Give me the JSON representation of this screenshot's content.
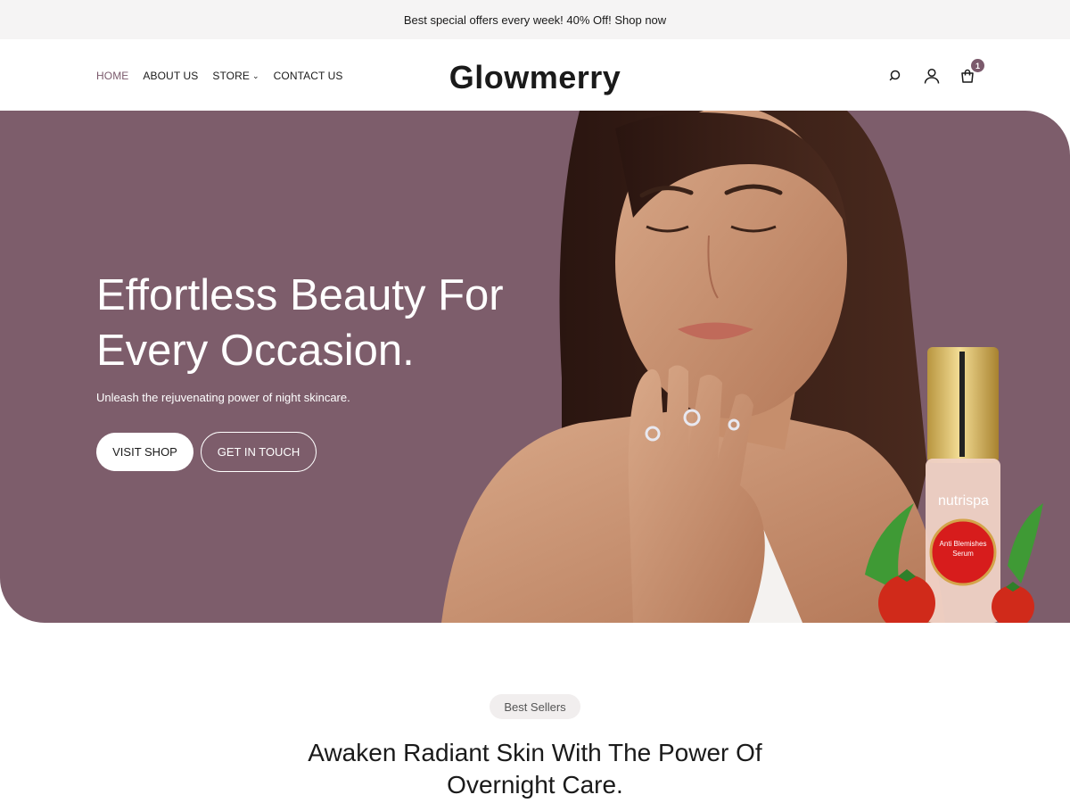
{
  "announcement": {
    "text": "Best special offers every week! 40% Off! Shop now"
  },
  "header": {
    "logo": "Glowmerry",
    "nav": [
      {
        "label": "HOME",
        "active": true
      },
      {
        "label": "ABOUT US"
      },
      {
        "label": "STORE",
        "has_dropdown": true
      },
      {
        "label": "CONTACT US"
      }
    ],
    "icons": [
      "search-icon",
      "user-icon",
      "cart-icon"
    ],
    "cart_count": "1"
  },
  "hero": {
    "title_line1": "Effortless Beauty For",
    "title_line2": "Every Occasion.",
    "subtitle": "Unleash the rejuvenating power of night skincare.",
    "primary_button": "VISIT SHOP",
    "secondary_button": "GET IN TOUCH",
    "background_color": "#7d5d6b",
    "product_brand": "nutrispa",
    "product_label_1": "Anti Blemishes",
    "product_label_2": "Serum"
  },
  "best_sellers": {
    "tag": "Best Sellers",
    "title_line1": "Awaken Radiant Skin With The Power Of",
    "title_line2": "Overnight Care."
  },
  "colors": {
    "accent": "#7b5a6c",
    "hero_bg": "#7d5d6b"
  }
}
